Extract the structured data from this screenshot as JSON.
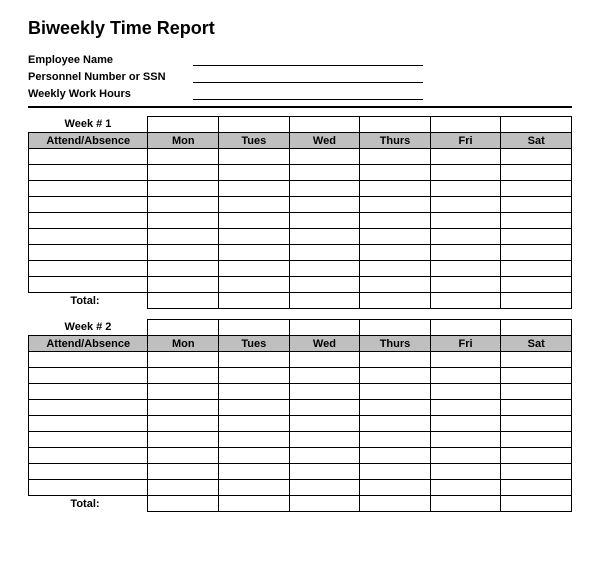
{
  "title": "Biweekly Time Report",
  "meta": {
    "employee_label": "Employee Name",
    "personnel_label": "Personnel Number or SSN",
    "hours_label": "Weekly Work Hours",
    "employee_value": "",
    "personnel_value": "",
    "hours_value": ""
  },
  "days": [
    "Mon",
    "Tues",
    "Wed",
    "Thurs",
    "Fri",
    "Sat"
  ],
  "attend_header": "Attend/Absence",
  "total_label": "Total:",
  "weeks": [
    {
      "label": "Week # 1",
      "rows": [
        [
          "",
          "",
          "",
          "",
          "",
          "",
          ""
        ],
        [
          "",
          "",
          "",
          "",
          "",
          "",
          ""
        ],
        [
          "",
          "",
          "",
          "",
          "",
          "",
          ""
        ],
        [
          "",
          "",
          "",
          "",
          "",
          "",
          ""
        ],
        [
          "",
          "",
          "",
          "",
          "",
          "",
          ""
        ],
        [
          "",
          "",
          "",
          "",
          "",
          "",
          ""
        ],
        [
          "",
          "",
          "",
          "",
          "",
          "",
          ""
        ],
        [
          "",
          "",
          "",
          "",
          "",
          "",
          ""
        ],
        [
          "",
          "",
          "",
          "",
          "",
          "",
          ""
        ]
      ],
      "totals": [
        "",
        "",
        "",
        "",
        "",
        ""
      ]
    },
    {
      "label": "Week # 2",
      "rows": [
        [
          "",
          "",
          "",
          "",
          "",
          "",
          ""
        ],
        [
          "",
          "",
          "",
          "",
          "",
          "",
          ""
        ],
        [
          "",
          "",
          "",
          "",
          "",
          "",
          ""
        ],
        [
          "",
          "",
          "",
          "",
          "",
          "",
          ""
        ],
        [
          "",
          "",
          "",
          "",
          "",
          "",
          ""
        ],
        [
          "",
          "",
          "",
          "",
          "",
          "",
          ""
        ],
        [
          "",
          "",
          "",
          "",
          "",
          "",
          ""
        ],
        [
          "",
          "",
          "",
          "",
          "",
          "",
          ""
        ],
        [
          "",
          "",
          "",
          "",
          "",
          "",
          ""
        ]
      ],
      "totals": [
        "",
        "",
        "",
        "",
        "",
        ""
      ]
    }
  ]
}
